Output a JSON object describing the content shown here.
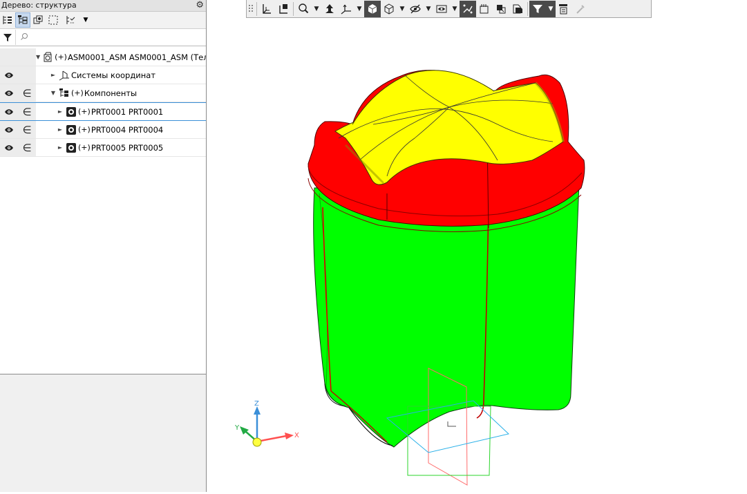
{
  "tree_panel": {
    "title": "Дерево: структура",
    "filter_placeholder": "",
    "rows": [
      {
        "label": "ASM0001_ASM ASM0001_ASM (Тел-",
        "eye": false,
        "include": false
      },
      {
        "label": "Системы координат",
        "eye": true,
        "include": false
      },
      {
        "label": "Компоненты",
        "eye": true,
        "include": true
      },
      {
        "label": "PRT0001 PRT0001",
        "eye": true,
        "include": true
      },
      {
        "label": "PRT0004 PRT0004",
        "eye": true,
        "include": true
      },
      {
        "label": "PRT0005 PRT0005",
        "eye": true,
        "include": true
      }
    ]
  },
  "viewport": {
    "triad": {
      "x_label": "X",
      "y_label": "Y",
      "z_label": "Z"
    },
    "colors": {
      "body": "#00ff00",
      "rim": "#ff0000",
      "lid": "#ffff00",
      "triad_x": "#ff5050",
      "triad_y": "#22aa44",
      "triad_z": "#3a8fd8"
    }
  },
  "icons": [
    "gear-icon",
    "filter-icon",
    "search-icon",
    "eye-icon",
    "include-icon",
    "assembly-icon",
    "coord-system-icon",
    "components-icon",
    "part-icon"
  ]
}
